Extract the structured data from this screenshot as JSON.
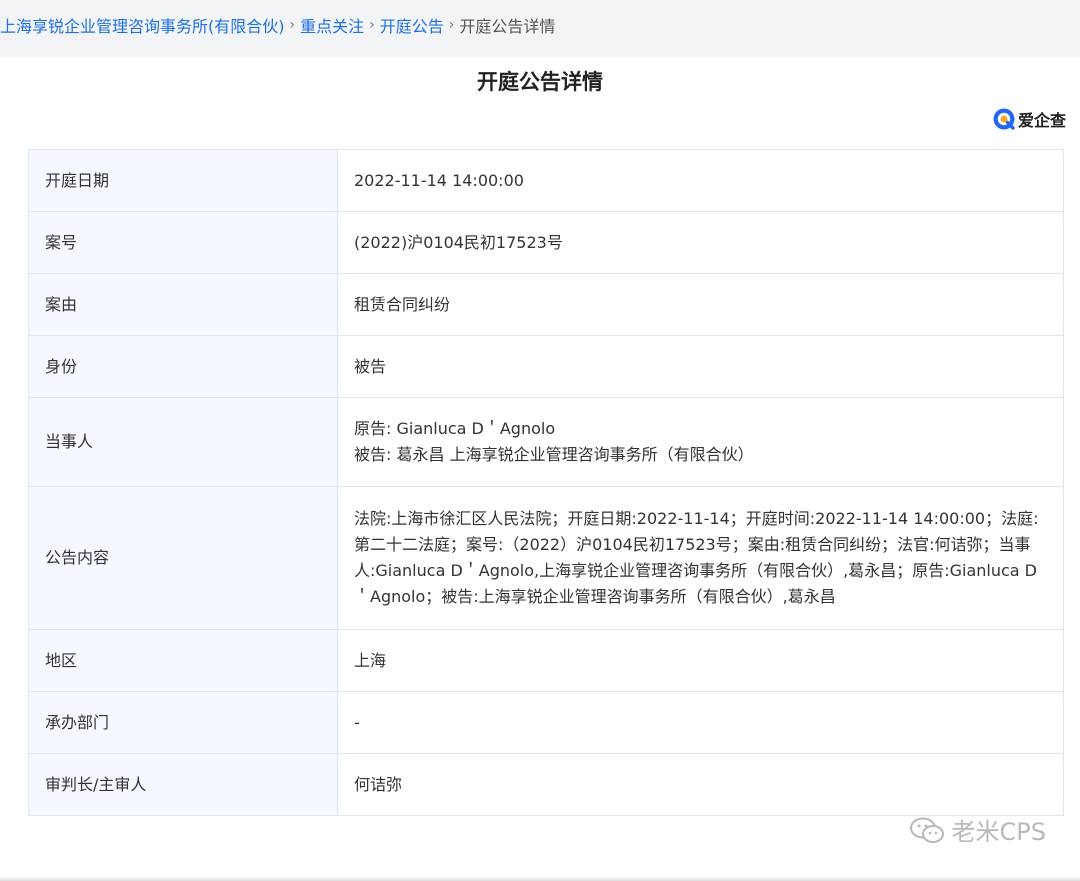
{
  "breadcrumb": {
    "items": [
      {
        "label": "上海享锐企业管理咨询事务所(有限合伙)"
      },
      {
        "label": "重点关注"
      },
      {
        "label": "开庭公告"
      }
    ],
    "current": "开庭公告详情",
    "separator": "›"
  },
  "page": {
    "title": "开庭公告详情"
  },
  "brand": {
    "name": "爱企查",
    "icon": "aiqicha-logo-icon",
    "accent": "#2468f2"
  },
  "details": {
    "rows": [
      {
        "label": "开庭日期",
        "lines": [
          "2022-11-14 14:00:00"
        ]
      },
      {
        "label": "案号",
        "lines": [
          "(2022)沪0104民初17523号"
        ]
      },
      {
        "label": "案由",
        "lines": [
          "租赁合同纠纷"
        ]
      },
      {
        "label": "身份",
        "lines": [
          "被告"
        ]
      },
      {
        "label": "当事人",
        "lines": [
          "原告: Gianluca D＇Agnolo",
          "被告: 葛永昌 上海享锐企业管理咨询事务所（有限合伙）"
        ]
      },
      {
        "label": "公告内容",
        "lines": [
          "法院:上海市徐汇区人民法院；开庭日期:2022-11-14；开庭时间:2022-11-14 14:00:00；法庭:第二十二法庭；案号:（2022）沪0104民初17523号；案由:租赁合同纠纷；法官:何诘弥；当事人:Gianluca D＇Agnolo,上海享锐企业管理咨询事务所（有限合伙）,葛永昌；原告:Gianluca D＇Agnolo；被告:上海享锐企业管理咨询事务所（有限合伙）,葛永昌"
        ]
      },
      {
        "label": "地区",
        "lines": [
          "上海"
        ]
      },
      {
        "label": "承办部门",
        "lines": [
          "-"
        ]
      },
      {
        "label": "审判长/主审人",
        "lines": [
          "何诘弥"
        ]
      }
    ]
  },
  "watermark": {
    "text": "老米CPS",
    "icon": "wechat-icon"
  },
  "colors": {
    "link": "#1f6fe5",
    "label_bg": "#f5f9ff",
    "border": "#dbe7f6",
    "page_bg": "#f3f4f6"
  }
}
